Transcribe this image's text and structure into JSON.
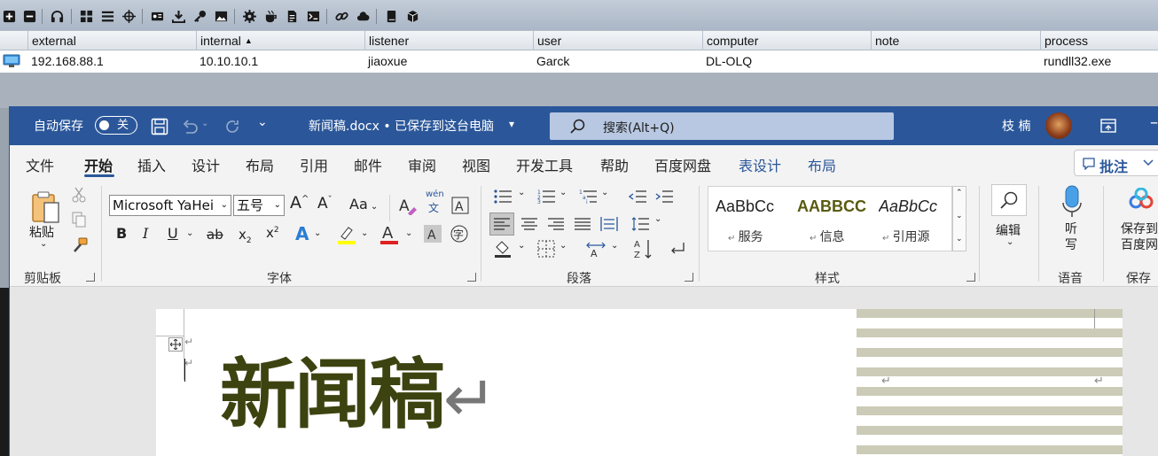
{
  "beacons": {
    "columns": [
      "external",
      "internal",
      "listener",
      "user",
      "computer",
      "note",
      "process"
    ],
    "sort_indicator": "▲",
    "rows": [
      {
        "external": "192.168.88.1",
        "internal": "10.10.10.1",
        "listener": "jiaoxue",
        "user": "Garck",
        "computer": "DL-OLQ",
        "note": "",
        "process": "rundll32.exe"
      }
    ]
  },
  "word": {
    "autosave_label": "自动保存",
    "autosave_state": "关",
    "doc_title": "新闻稿.docx • 已保存到这台电脑",
    "title_arrow": "▾",
    "search_placeholder": "搜索(Alt+Q)",
    "user_name": "枝 楠",
    "tabs": [
      "文件",
      "开始",
      "插入",
      "设计",
      "布局",
      "引用",
      "邮件",
      "审阅",
      "视图",
      "开发工具",
      "帮助",
      "百度网盘",
      "表设计",
      "布局"
    ],
    "active_tab": "开始",
    "comment_label": "批注",
    "clipboard": {
      "paste": "粘贴",
      "group": "剪贴板"
    },
    "font": {
      "family": "Microsoft YaHei",
      "size": "五号",
      "group": "字体",
      "phonetic": "wén",
      "phonetic_char": "文",
      "case_label": "Aa"
    },
    "paragraph": {
      "group": "段落"
    },
    "styles": {
      "group": "样式",
      "items": [
        {
          "sample": "AaBbCc",
          "label": "服务"
        },
        {
          "sample": "AABBCC",
          "label": "信息"
        },
        {
          "sample": "AaBbCc",
          "label": "引用源"
        }
      ]
    },
    "editing": {
      "label": "编辑"
    },
    "voice": {
      "label": "听写",
      "group": "语音"
    },
    "save": {
      "label": "保存到百度网盘",
      "group": "保存"
    },
    "document": {
      "headline": "新闻稿"
    }
  },
  "colors": {
    "word_blue": "#2b579a",
    "headline_green": "#3c4310",
    "stripe": "#cbcbb7",
    "highlight_yellow": "#ffff00",
    "font_red": "#e02020"
  }
}
